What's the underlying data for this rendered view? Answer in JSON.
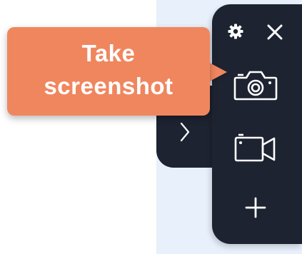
{
  "tooltip": {
    "line1": "Take",
    "line2": "screenshot",
    "color": "#f0865e"
  },
  "toolbar": {
    "background": "#1e2332",
    "icons": {
      "settings": "gear-icon",
      "close": "close-icon",
      "screenshot": "camera-icon",
      "record": "video-camera-icon",
      "add": "plus-icon",
      "expand": "chevron-right-icon"
    }
  }
}
